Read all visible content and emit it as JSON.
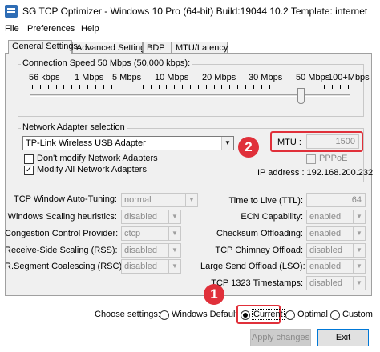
{
  "window": {
    "title": "SG TCP Optimizer - Windows 10 Pro (64-bit) Build:19044 10.2  Template: internet"
  },
  "menu": [
    "File",
    "Preferences",
    "Help"
  ],
  "tabs": [
    "General Settings",
    "Advanced Settings",
    "BDP",
    "MTU/Latency"
  ],
  "connection_speed": {
    "label": "Connection Speed  50 Mbps (50,000 kbps):",
    "ticks": [
      "56 kbps",
      "1 Mbps",
      "5 Mbps",
      "10 Mbps",
      "20 Mbps",
      "30 Mbps",
      "50 Mbps",
      "100+Mbps"
    ],
    "selected_fraction": 0.85
  },
  "adapter": {
    "label": "Network Adapter selection",
    "selected": "TP-Link Wireless USB Adapter",
    "dont_modify": "Don't modify Network Adapters",
    "modify_all": "Modify All Network Adapters",
    "mtu_label": "MTU :",
    "mtu_value": "1500",
    "pppoe": "PPPoE",
    "ip": "IP address : 192.168.200.232"
  },
  "badges": {
    "one": "1",
    "two": "2"
  },
  "left_settings": [
    {
      "label": "TCP Window Auto-Tuning:",
      "value": "normal"
    },
    {
      "label": "Windows Scaling heuristics:",
      "value": "disabled"
    },
    {
      "label": "Congestion Control Provider:",
      "value": "ctcp"
    },
    {
      "label": "Receive-Side Scaling (RSS):",
      "value": "disabled"
    },
    {
      "label": "R.Segment Coalescing (RSC):",
      "value": "disabled"
    }
  ],
  "right_settings": [
    {
      "label": "Time to Live (TTL):",
      "value": "64"
    },
    {
      "label": "ECN Capability:",
      "value": "enabled"
    },
    {
      "label": "Checksum Offloading:",
      "value": "enabled"
    },
    {
      "label": "TCP Chimney Offload:",
      "value": "disabled"
    },
    {
      "label": "Large Send Offload (LSO):",
      "value": "enabled"
    },
    {
      "label": "TCP 1323 Timestamps:",
      "value": "disabled"
    }
  ],
  "choose": {
    "label": "Choose settings:",
    "options": [
      "Windows Default",
      "Current",
      "Optimal",
      "Custom"
    ],
    "selected": "Current"
  },
  "buttons": {
    "apply": "Apply changes",
    "exit": "Exit"
  },
  "colors": {
    "annotation_red": "#e0303a",
    "focus_blue": "#0078d7"
  }
}
